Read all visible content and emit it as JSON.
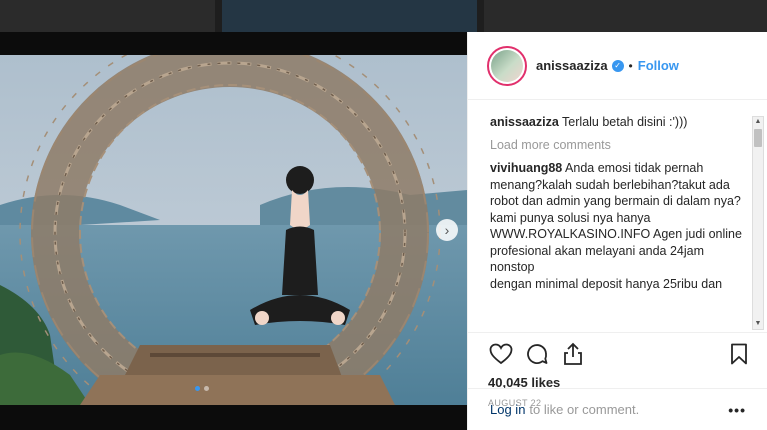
{
  "post": {
    "username": "anissaaziza",
    "follow_label": "Follow",
    "separator": "•",
    "verified_glyph": "✓",
    "caption_user": "anissaaziza",
    "caption_text": "Terlalu betah disini :')))",
    "load_more": "Load more comments",
    "comments": [
      {
        "user": "vivihuang88",
        "text": "Anda emosi tidak pernah menang?kalah sudah berlebihan?takut ada robot dan admin yang bermain di dalam nya?",
        "extra": [
          "kami punya solusi nya hanya WWW.ROYALKASINO.INFO Agen judi online profesional akan melayani anda 24jam nonstop",
          "dengan minimal deposit hanya 25ribu dan"
        ]
      }
    ],
    "likes": "40,045 likes",
    "date": "AUGUST 22",
    "login_link": "Log in",
    "login_text": "to like or comment.",
    "more_menu": "•••"
  },
  "carousel": {
    "next_arrow": "›",
    "slides": 2,
    "active_slide": 1
  },
  "icons": {
    "like": "heart-icon",
    "comment": "comment-icon",
    "share": "share-icon",
    "save": "bookmark-icon"
  },
  "colors": {
    "link_blue": "#3897f0",
    "login_blue": "#003569",
    "text": "#262626",
    "muted": "#999999"
  }
}
